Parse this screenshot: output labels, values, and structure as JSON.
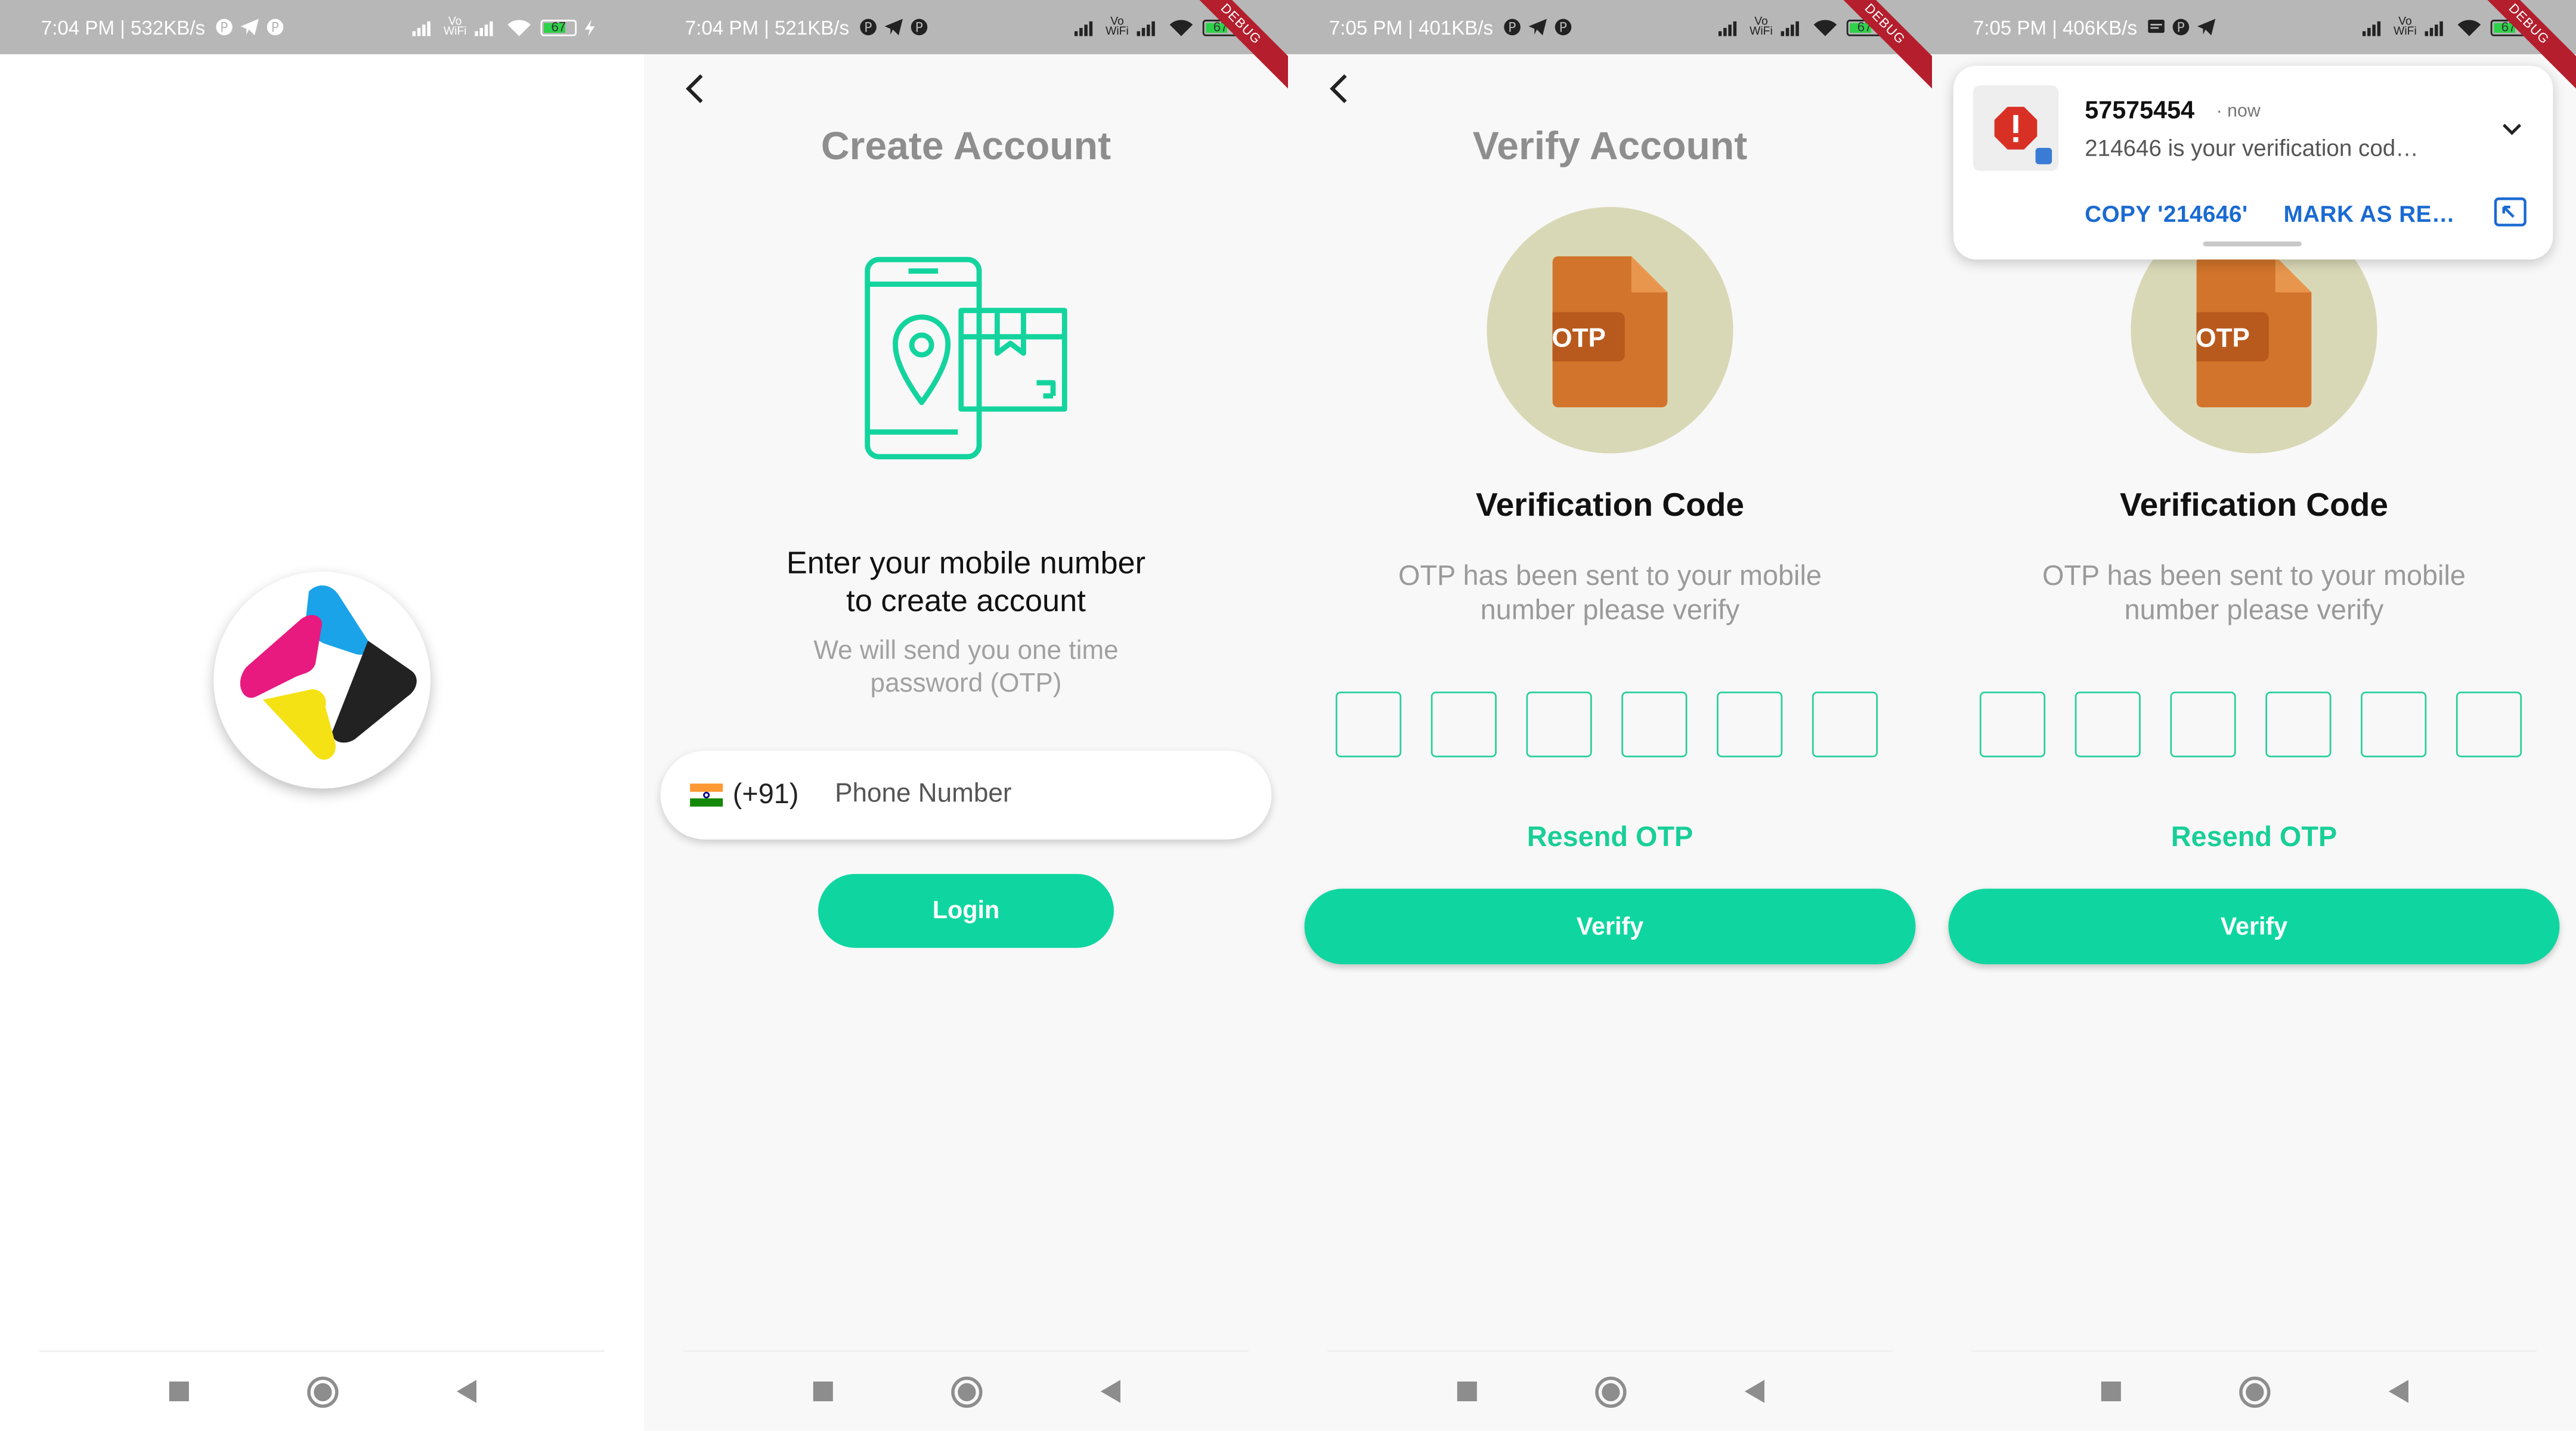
{
  "colors": {
    "accent": "#0fd6a0",
    "accent_text": "#18cf97",
    "status_bar": "#b7b7b7",
    "debug_banner": "#b41e2d",
    "otp_circle": "#d9d8b6",
    "otp_document": "#d2742b",
    "illustration_stroke": "#14d49e",
    "link_blue": "#1a6ad1"
  },
  "screens": [
    {
      "status_bar": {
        "time": "7:04 PM",
        "speed": "532KB/s",
        "battery": "67"
      },
      "logo_icon": "app-logo-icon"
    },
    {
      "status_bar": {
        "time": "7:04 PM",
        "speed": "521KB/s",
        "battery": "67"
      },
      "debug_banner": "DEBUG",
      "title": "Create Account",
      "illustration_icon": "phone-location-package-icon",
      "heading_line1": "Enter your mobile number",
      "heading_line2": "to create account",
      "subheading_line1": "We will send you one time",
      "subheading_line2": "password (OTP)",
      "country_code": "(+91)",
      "phone_placeholder": "Phone Number",
      "login_label": "Login"
    },
    {
      "status_bar": {
        "time": "7:05 PM",
        "speed": "401KB/s",
        "battery": "67"
      },
      "debug_banner": "DEBUG",
      "title": "Verify Account",
      "otp_badge": "OTP",
      "verification_title": "Verification Code",
      "subtitle_line1": "OTP has been sent to your mobile",
      "subtitle_line2": "number please verify",
      "resend_label": "Resend OTP",
      "verify_label": "Verify"
    },
    {
      "status_bar": {
        "time": "7:05 PM",
        "speed": "406KB/s",
        "battery": "67"
      },
      "debug_banner": "DEBUG",
      "otp_badge": "OTP",
      "verification_title": "Verification Code",
      "subtitle_line1": "OTP has been sent to your mobile",
      "subtitle_line2": "number please verify",
      "resend_label": "Resend OTP",
      "verify_label": "Verify",
      "notification": {
        "sender": "57575454",
        "time": "now",
        "message": "214646 is your verification cod…",
        "action_copy": "COPY '214646'",
        "action_mark": "MARK AS RE…"
      }
    }
  ]
}
